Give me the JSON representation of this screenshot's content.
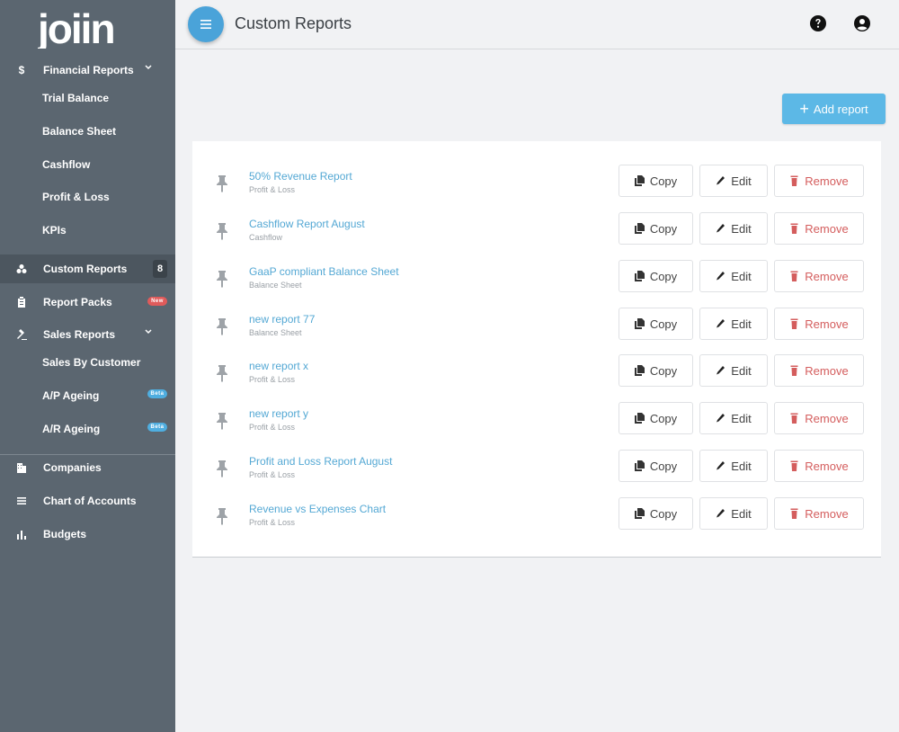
{
  "brand": {
    "logo_text": "joiin"
  },
  "sidebar": {
    "financial_reports": "Financial Reports",
    "financial_sub": [
      "Trial Balance",
      "Balance Sheet",
      "Cashflow",
      "Profit & Loss",
      "KPIs"
    ],
    "custom_reports": "Custom Reports",
    "custom_reports_count": "8",
    "report_packs": "Report Packs",
    "new_badge": "New",
    "sales_reports": "Sales Reports",
    "sales_sub": [
      "Sales By Customer",
      "A/P Ageing",
      "A/R Ageing"
    ],
    "beta_badge": "Beta",
    "companies": "Companies",
    "chart_of_accounts": "Chart of Accounts",
    "budgets": "Budgets",
    "dollar_symbol": "$"
  },
  "header": {
    "title": "Custom Reports"
  },
  "actions": {
    "add_report": "Add report",
    "copy": "Copy",
    "edit": "Edit",
    "remove": "Remove"
  },
  "reports": [
    {
      "name": "50% Revenue Report",
      "type": "Profit & Loss"
    },
    {
      "name": "Cashflow Report August",
      "type": "Cashflow"
    },
    {
      "name": "GaaP compliant Balance Sheet",
      "type": "Balance Sheet"
    },
    {
      "name": "new report 77",
      "type": "Balance Sheet"
    },
    {
      "name": "new report x",
      "type": "Profit & Loss"
    },
    {
      "name": "new report y",
      "type": "Profit & Loss"
    },
    {
      "name": "Profit and Loss Report August",
      "type": "Profit & Loss"
    },
    {
      "name": "Revenue vs Expenses Chart",
      "type": "Profit & Loss"
    }
  ],
  "colors": {
    "sidebar": "#5b6670",
    "accent": "#5cb8e6",
    "link": "#54a8d4",
    "danger": "#d45d5d"
  }
}
